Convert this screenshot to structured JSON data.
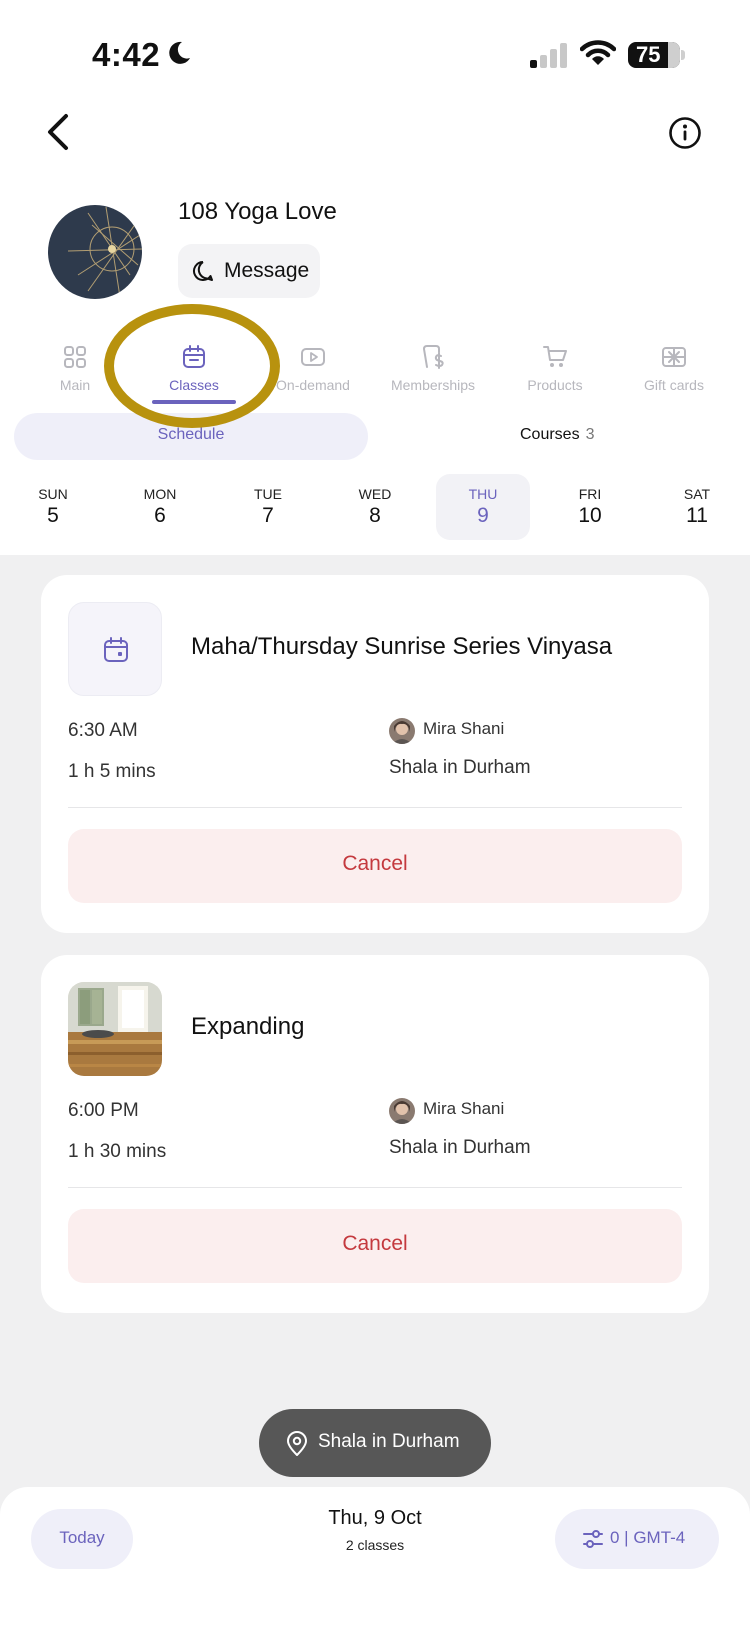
{
  "status_bar": {
    "time": "4:42",
    "battery": "75"
  },
  "header": {
    "studio_name": "108 Yoga Love",
    "message_label": "Message"
  },
  "tabs": [
    {
      "label": "Main",
      "icon": "grid-icon"
    },
    {
      "label": "Classes",
      "icon": "calendar-icon",
      "active": true
    },
    {
      "label": "On-demand",
      "icon": "play-icon"
    },
    {
      "label": "Memberships",
      "icon": "membership-icon"
    },
    {
      "label": "Products",
      "icon": "cart-icon"
    },
    {
      "label": "Gift cards",
      "icon": "gift-icon"
    }
  ],
  "segment": {
    "schedule": "Schedule",
    "courses": "Courses",
    "courses_count": "3"
  },
  "days": [
    {
      "name": "SUN",
      "date": "5"
    },
    {
      "name": "MON",
      "date": "6"
    },
    {
      "name": "TUE",
      "date": "7"
    },
    {
      "name": "WED",
      "date": "8"
    },
    {
      "name": "THU",
      "date": "9",
      "selected": true
    },
    {
      "name": "FRI",
      "date": "10"
    },
    {
      "name": "SAT",
      "date": "11"
    }
  ],
  "classes": [
    {
      "title": "Maha/Thursday Sunrise Series Vinyasa",
      "time": "6:30 AM",
      "duration": "1 h 5 mins",
      "instructor": "Mira Shani",
      "location": "Shala in Durham",
      "action": "Cancel"
    },
    {
      "title": "Expanding",
      "time": "6:00 PM",
      "duration": "1 h 30 mins",
      "instructor": "Mira Shani",
      "location": "Shala in Durham",
      "action": "Cancel"
    }
  ],
  "location_pill": "Shala in Durham",
  "bottom_bar": {
    "today": "Today",
    "date": "Thu, 9 Oct",
    "count": "2 classes",
    "timezone": "0 | GMT-4"
  },
  "colors": {
    "accent": "#6b63bd",
    "cancel_text": "#c4393e",
    "cancel_bg": "#fbeeee",
    "highlight": "#b8920e"
  }
}
